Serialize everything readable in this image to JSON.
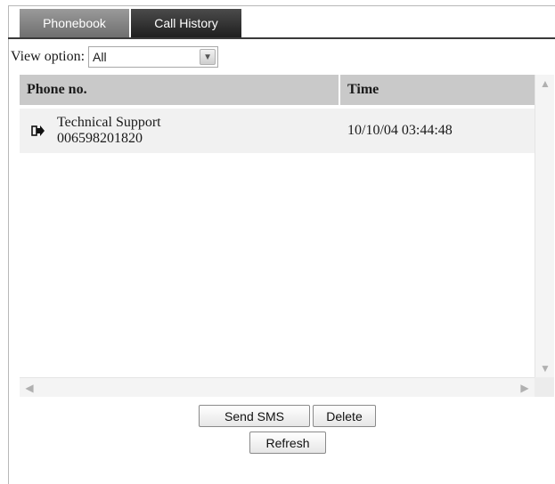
{
  "tabs": [
    {
      "label": "Phonebook",
      "active": false
    },
    {
      "label": "Call History",
      "active": true
    }
  ],
  "view": {
    "label": "View option:",
    "selected": "All"
  },
  "table": {
    "columns": [
      "Phone no.",
      "Time"
    ],
    "rows": [
      {
        "direction_icon": "outgoing-call-icon",
        "name": "Technical Support",
        "number": "006598201820",
        "time": "10/10/04 03:44:48"
      }
    ]
  },
  "buttons": {
    "send_sms": "Send SMS",
    "delete": "Delete",
    "refresh": "Refresh"
  },
  "colors": {
    "header_bg": "#c9c9c9",
    "active_tab": "#2b2b2b",
    "inactive_tab": "#808080",
    "row_bg": "#f1f1f1"
  }
}
